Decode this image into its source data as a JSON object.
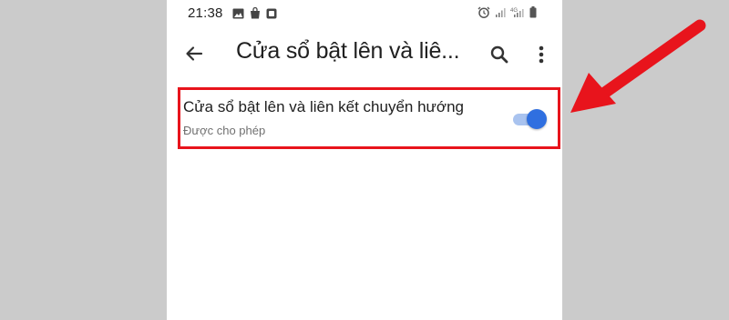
{
  "status_bar": {
    "time": "21:38"
  },
  "app_bar": {
    "title": "Cửa sổ bật lên và liê..."
  },
  "setting": {
    "title": "Cửa sổ bật lên và liên kết chuyển hướng",
    "subtitle": "Được cho phép",
    "toggle_on": true
  },
  "colors": {
    "accent": "#2f6fe0",
    "highlight": "#e8141c",
    "background": "#cbcbcb"
  },
  "icons": {
    "status_left": [
      "image-icon",
      "bag-icon",
      "app-icon"
    ],
    "status_right": [
      "alarm-icon",
      "signal-icon",
      "4g-signal-icon",
      "battery-icon"
    ],
    "app_bar": [
      "back-arrow-icon",
      "search-icon",
      "more-vert-icon"
    ]
  }
}
